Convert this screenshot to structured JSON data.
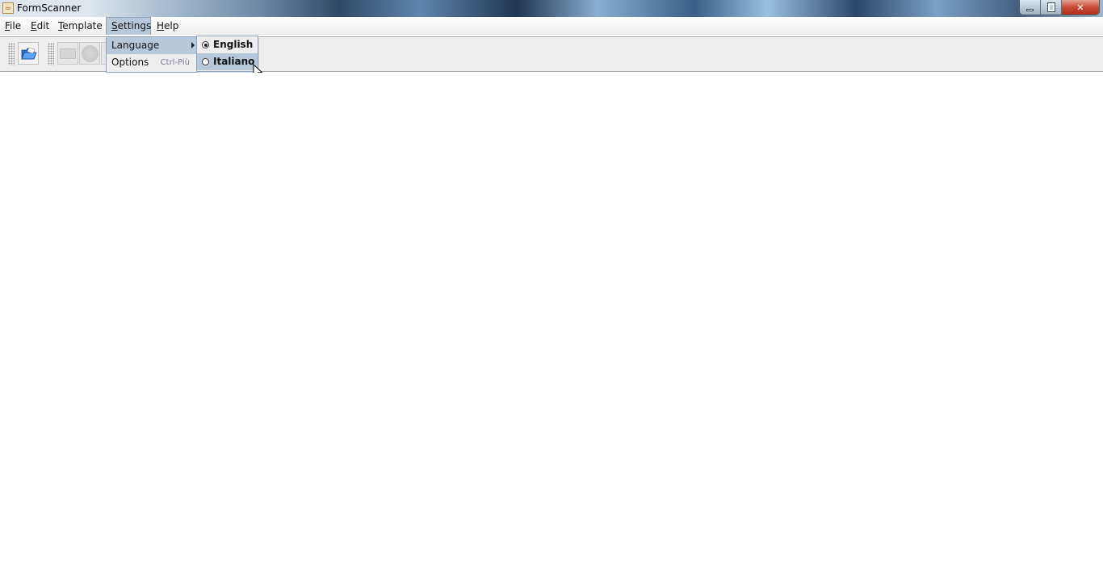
{
  "window": {
    "title": "FormScanner",
    "icon": "java-app-icon",
    "controls": {
      "minimize": "minimize-icon",
      "maximize": "restore-icon",
      "close": "close-icon"
    }
  },
  "menubar": {
    "items": [
      {
        "label": "File",
        "mnemonic": "F"
      },
      {
        "label": "Edit",
        "mnemonic": "E"
      },
      {
        "label": "Template",
        "mnemonic": "T"
      },
      {
        "label": "Settings",
        "mnemonic": "S",
        "active": true
      },
      {
        "label": "Help",
        "mnemonic": "H"
      }
    ]
  },
  "toolbar": {
    "buttons": [
      {
        "icon": "open-folder-icon",
        "enabled": true
      },
      {
        "icon": "rectangle-icon",
        "enabled": false
      },
      {
        "icon": "circle-icon",
        "enabled": false
      }
    ]
  },
  "settings_menu": {
    "items": [
      {
        "label": "Language",
        "has_submenu": true,
        "highlighted": true
      },
      {
        "label": "Options",
        "shortcut": "Ctrl-Più",
        "highlighted": false
      }
    ]
  },
  "language_submenu": {
    "items": [
      {
        "label": "English",
        "selected": true,
        "highlighted": false
      },
      {
        "label": "Italiano",
        "selected": false,
        "highlighted": true
      }
    ]
  }
}
